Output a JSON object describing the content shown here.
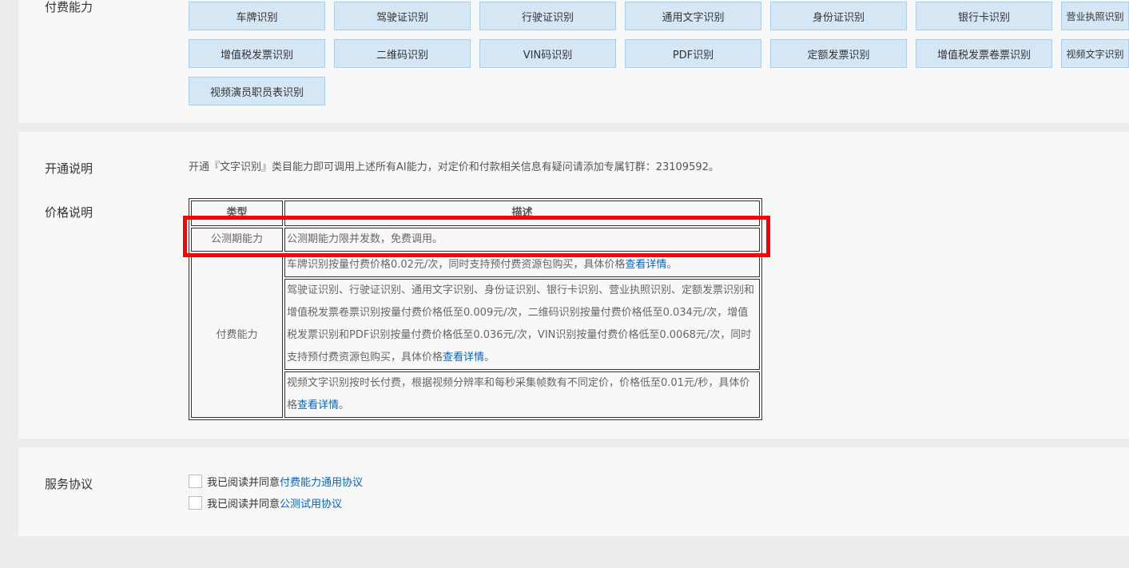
{
  "paid": {
    "label": "付费能力",
    "buttons": [
      "车牌识别",
      "驾驶证识别",
      "行驶证识别",
      "通用文字识别",
      "身份证识别",
      "银行卡识别",
      "营业执照识别",
      "增值税发票识别",
      "二维码识别",
      "VIN码识别",
      "PDF识别",
      "定额发票识别",
      "增值税发票卷票识别",
      "视频文字识别",
      "视频演员职员表识别"
    ]
  },
  "intro": {
    "label": "开通说明",
    "text": "开通『文字识别』类目能力即可调用上述所有AI能力，对定价和付款相关信息有疑问请添加专属钉群：23109592。"
  },
  "price": {
    "label": "价格说明",
    "headers": [
      "类型",
      "描述"
    ],
    "beta_type": "公测期能力",
    "beta_desc": "公测期能力限并发数，免费调用。",
    "paid_type": "付费能力",
    "rows": [
      {
        "text": "车牌识别按量付费价格0.02元/次，同时支持预付费资源包购买，具体价格",
        "link": "查看详情",
        "end": "。"
      },
      {
        "text": "驾驶证识别、行驶证识别、通用文字识别、身份证识别、银行卡识别、营业执照识别、定额发票识别和增值税发票卷票识别按量付费价格低至0.009元/次，二维码识别按量付费价格低至0.034元/次，增值税发票识别和PDF识别按量付费价格低至0.036元/次，VIN识别按量付费价格低至0.0068元/次，同时支持预付费资源包购买，具体价格",
        "link": "查看详情",
        "end": "。"
      },
      {
        "text": "视频文字识别按时长付费，根据视频分辨率和每秒采集帧数有不同定价，价格低至0.01元/秒，具体价格",
        "link": "查看详情",
        "end": "。"
      }
    ]
  },
  "agreement": {
    "label": "服务协议",
    "items": [
      {
        "prefix": "我已阅读并同意",
        "link": "付费能力通用协议"
      },
      {
        "prefix": "我已阅读并同意",
        "link": "公测试用协议"
      }
    ]
  },
  "colors": {
    "highlight": "#ff0000",
    "link": "#0066cc",
    "button_bg": "#d5e6f5"
  }
}
